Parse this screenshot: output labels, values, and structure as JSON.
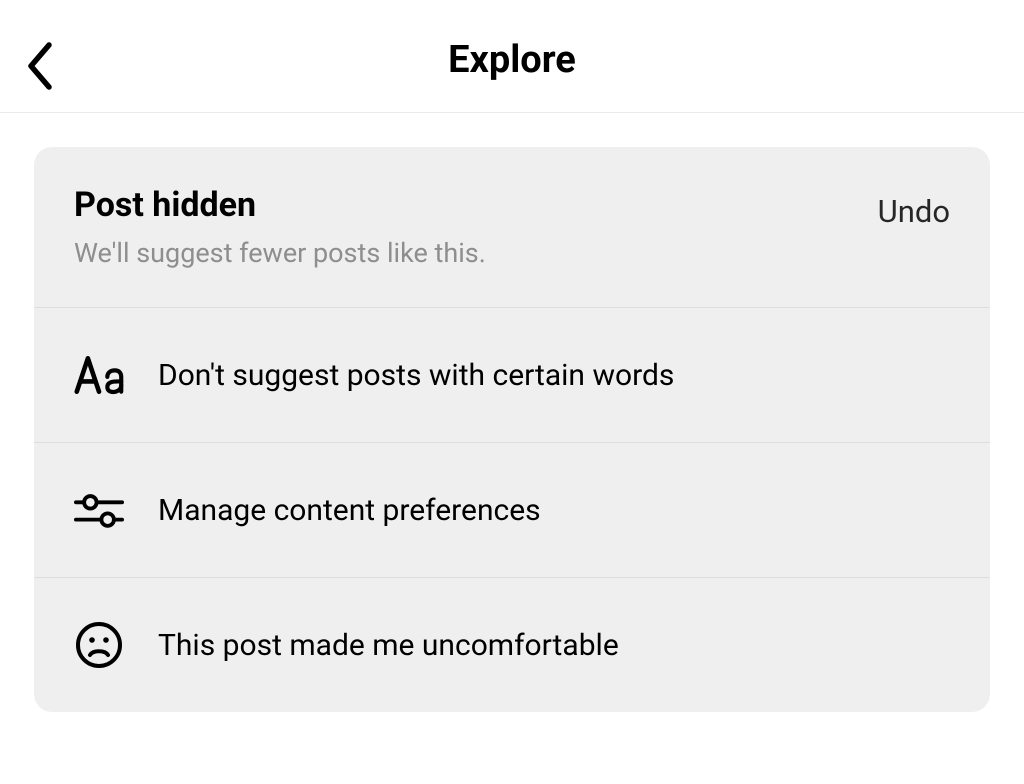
{
  "header": {
    "title": "Explore"
  },
  "card": {
    "title": "Post hidden",
    "subtitle": "We'll suggest fewer posts like this.",
    "undo_label": "Undo",
    "options": [
      {
        "icon": "aa-icon",
        "label": "Don't suggest posts with certain words"
      },
      {
        "icon": "sliders-icon",
        "label": "Manage content preferences"
      },
      {
        "icon": "sad-face-icon",
        "label": "This post made me uncomfortable"
      }
    ]
  }
}
